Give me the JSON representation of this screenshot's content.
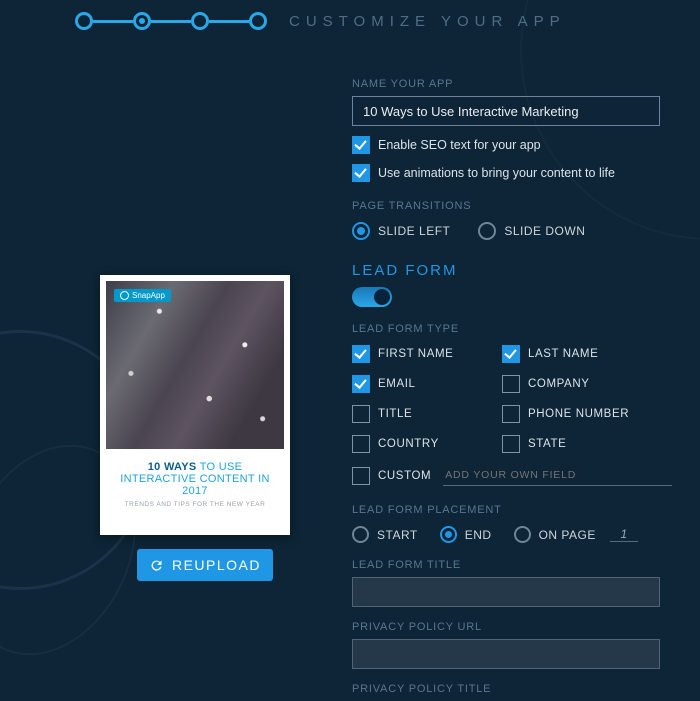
{
  "stepper": {
    "title": "CUSTOMIZE YOUR APP"
  },
  "preview": {
    "brand": "SnapApp",
    "title_bold": "10 WAYS",
    "title_rest": " TO USE INTERACTIVE CONTENT IN 2017",
    "subtitle": "TRENDS AND TIPS FOR THE NEW YEAR"
  },
  "reupload_label": "REUPLOAD",
  "form": {
    "name_label": "NAME YOUR APP",
    "name_value": "10 Ways to Use Interactive Marketing",
    "seo_label": "Enable SEO text for your app",
    "anim_label": "Use animations to bring your content to life",
    "transitions_label": "PAGE TRANSITIONS",
    "transitions": {
      "slide_left": "SLIDE LEFT",
      "slide_down": "SLIDE DOWN"
    },
    "lead_form_title": "LEAD FORM",
    "lead_type_label": "LEAD FORM TYPE",
    "fields": {
      "first_name": "FIRST NAME",
      "last_name": "LAST NAME",
      "email": "EMAIL",
      "company": "COMPANY",
      "title": "TITLE",
      "phone": "PHONE NUMBER",
      "country": "COUNTRY",
      "state": "STATE",
      "custom": "CUSTOM",
      "custom_placeholder": "ADD YOUR OWN FIELD"
    },
    "placement_label": "LEAD FORM PLACEMENT",
    "placement": {
      "start": "START",
      "end": "END",
      "on_page": "ON PAGE",
      "page_value": "1"
    },
    "lf_title_label": "LEAD FORM TITLE",
    "privacy_url_label": "PRIVACY POLICY URL",
    "privacy_title_label": "PRIVACY POLICY TITLE"
  }
}
